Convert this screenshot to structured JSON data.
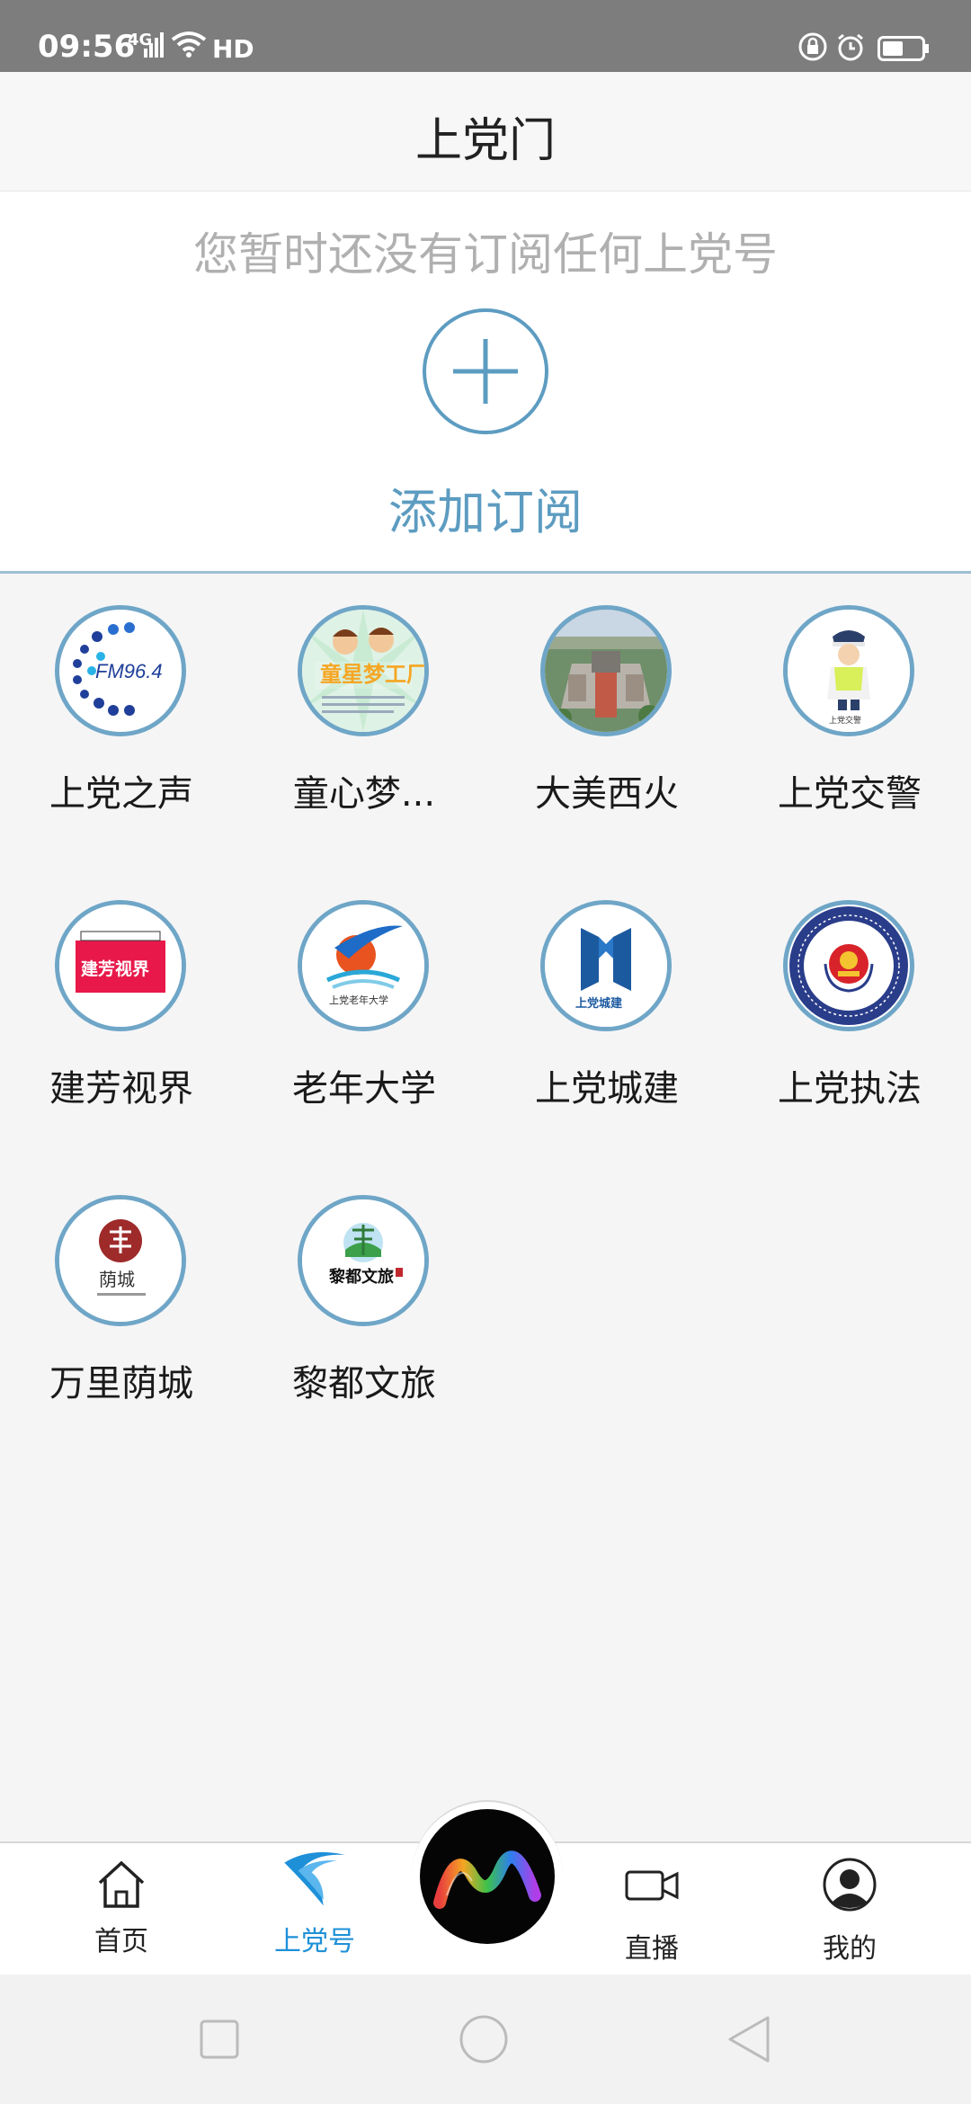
{
  "status_bar": {
    "time": "09:56",
    "network": "4G",
    "hd": "HD"
  },
  "header": {
    "title": "上党门"
  },
  "subscribe": {
    "empty_message": "您暂时还没有订阅任何上党号",
    "add_label": "添加订阅"
  },
  "channels": [
    {
      "label": "上党之声",
      "icon": "fm-radio-logo",
      "logo_text": "FM96.4"
    },
    {
      "label": "童心梦...",
      "icon": "children-dream-logo",
      "logo_text": "童星梦工厂"
    },
    {
      "label": "大美西火",
      "icon": "aerial-town-photo"
    },
    {
      "label": "上党交警",
      "icon": "traffic-police-logo",
      "logo_text": "上党交警"
    },
    {
      "label": "建芳视界",
      "icon": "jianfang-view-logo",
      "logo_text": "建芳视界"
    },
    {
      "label": "老年大学",
      "icon": "senior-university-logo",
      "logo_text": "上党老年大学"
    },
    {
      "label": "上党城建",
      "icon": "urban-construction-logo",
      "logo_text": "上党城建"
    },
    {
      "label": "上党执法",
      "icon": "law-enforcement-emblem"
    },
    {
      "label": "万里荫城",
      "icon": "yincheng-logo",
      "logo_text": "荫城"
    },
    {
      "label": "黎都文旅",
      "icon": "lidu-tourism-logo",
      "logo_text": "黎都文旅"
    }
  ],
  "tabbar": {
    "items": [
      {
        "label": "首页",
        "icon": "home-icon"
      },
      {
        "label": "上党号",
        "icon": "shangdang-wave-icon",
        "active": true
      },
      {
        "label": "",
        "icon": "center-logo-icon"
      },
      {
        "label": "直播",
        "icon": "video-camera-icon"
      },
      {
        "label": "我的",
        "icon": "profile-icon"
      }
    ]
  },
  "colors": {
    "accent": "#5d9cc1",
    "active_tab": "#1e90d8",
    "avatar_border": "#6fa6c7",
    "status_bar": "#7d7d7d"
  }
}
